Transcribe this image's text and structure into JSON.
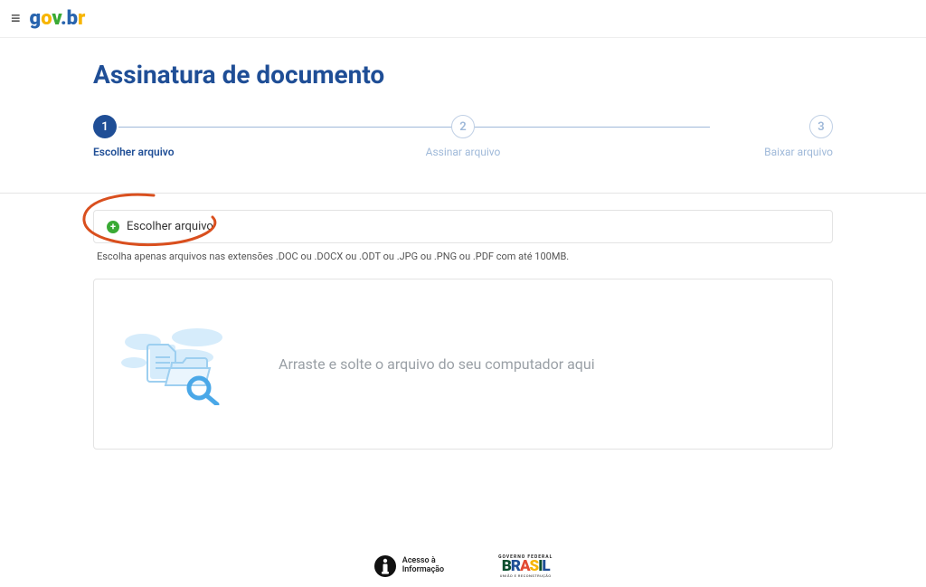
{
  "header": {
    "logo_g": "g",
    "logo_o": "o",
    "logo_v": "v",
    "logo_dot": ".",
    "logo_b": "b",
    "logo_r": "r"
  },
  "page": {
    "title": "Assinatura de documento"
  },
  "stepper": {
    "steps": [
      {
        "num": "1",
        "label": "Escolher arquivo",
        "active": true
      },
      {
        "num": "2",
        "label": "Assinar arquivo",
        "active": false
      },
      {
        "num": "3",
        "label": "Baixar arquivo",
        "active": false
      }
    ]
  },
  "chooseFile": {
    "label": "Escolher arquivo"
  },
  "helper": {
    "text": "Escolha apenas arquivos nas extensões .DOC ou .DOCX ou .ODT ou .JPG ou .PNG ou .PDF com até 100MB."
  },
  "dropzone": {
    "text": "Arraste e solte o arquivo do seu computador aqui"
  },
  "footer": {
    "info_line1": "Acesso à",
    "info_line2": "Informação",
    "brasil_top": "GOVERNO FEDERAL",
    "brasil_sub": "UNIÃO E RECONSTRUÇÃO"
  }
}
